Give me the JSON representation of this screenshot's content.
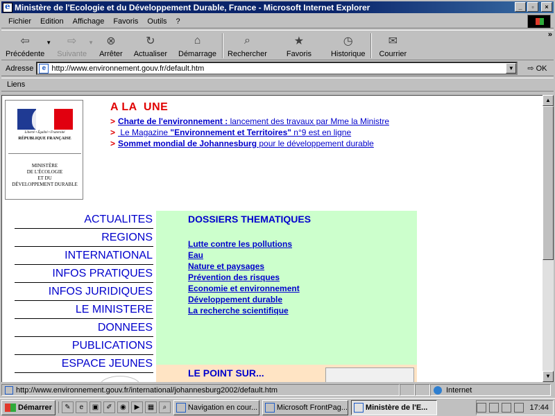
{
  "window": {
    "title": "Ministère de l'Ecologie et du Développement Durable, France - Microsoft Internet Explorer",
    "controls": [
      "_",
      "▫",
      "×"
    ]
  },
  "menu": [
    "Fichier",
    "Edition",
    "Affichage",
    "Favoris",
    "Outils",
    "?"
  ],
  "toolbar": {
    "back": "Précédente",
    "forward": "Suivante",
    "stop": "Arrêter",
    "refresh": "Actualiser",
    "home": "Démarrage",
    "search": "Rechercher",
    "favorites": "Favoris",
    "history": "Historique",
    "mail": "Courrier",
    "more": "»"
  },
  "address": {
    "label": "Adresse",
    "url": "http://www.environnement.gouv.fr/default.htm",
    "go": "OK"
  },
  "links_label": "Liens",
  "logo": {
    "devise": "Liberté • Égalité • Fraternité",
    "republique": "RÉPUBLIQUE FRANÇAISE",
    "ministere": [
      "MINISTÈRE",
      "DE L'ÉCOLOGIE",
      "ET DU",
      "DÉVELOPPEMENT DURABLE"
    ],
    "flag_colors": [
      "#1f3a93",
      "#ffffff",
      "#e1000f"
    ]
  },
  "headline": {
    "title": "A LA  UNE",
    "news": [
      {
        "arrow": ">",
        "bold": "Charte de l'environnement :",
        "text": " lancement des travaux par Mme la Ministre"
      },
      {
        "arrow": ">",
        "prefix": " Le Magazine ",
        "bold": "\"Environnement et Territoires\"",
        "text": " n°9 est en ligne"
      },
      {
        "arrow": ">",
        "bold": "Sommet mondial de Johannesburg",
        "text": " pour le développement durable"
      }
    ]
  },
  "nav": [
    "ACTUALITES",
    "REGIONS",
    "INTERNATIONAL",
    "INFOS PRATIQUES",
    "INFOS JURIDIQUES",
    "LE MINISTERE",
    "DONNEES",
    "PUBLICATIONS",
    "ESPACE JEUNES"
  ],
  "dossiers": {
    "title": "DOSSIERS THEMATIQUES",
    "links": [
      "Lutte contre les pollutions",
      "Eau",
      "Nature et paysages",
      "Prévention des risques",
      "Economie et environnement",
      "Développement durable",
      "La recherche scientifique"
    ]
  },
  "point_sur": "LE POINT SUR...",
  "status": {
    "url": "http://www.environnement.gouv.fr/international/johannesburg2002/default.htm",
    "zone": "Internet"
  },
  "taskbar": {
    "start": "Démarrer",
    "tasks": [
      {
        "label": "Navigation en cour...",
        "active": false
      },
      {
        "label": "Microsoft FrontPag...",
        "active": false
      },
      {
        "label": "Ministère de l'E...",
        "active": true
      }
    ],
    "clock": "17:44"
  }
}
